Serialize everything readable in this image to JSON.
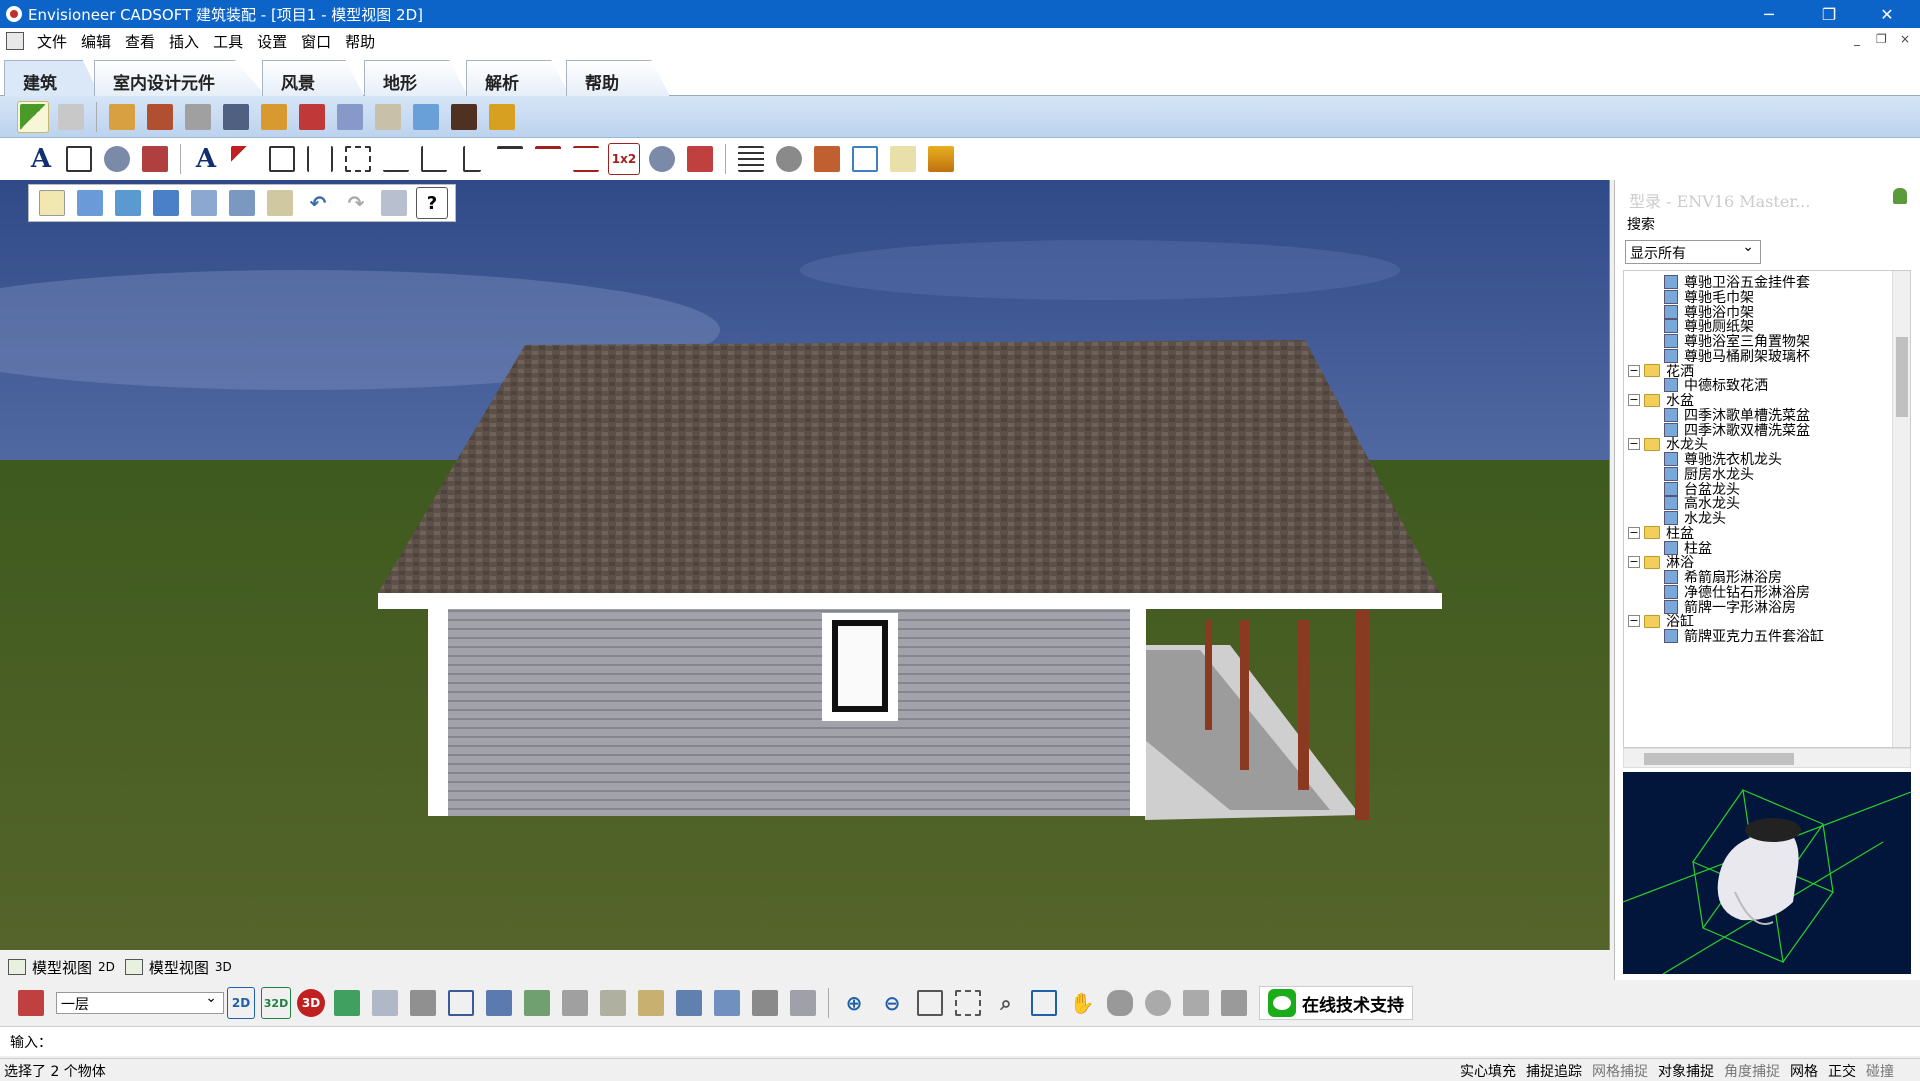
{
  "window": {
    "title": "Envisioneer CADSOFT 建筑装配 - [项目1 - 模型视图 2D]",
    "controls": [
      "─",
      "❐",
      "✕"
    ]
  },
  "menu": [
    "文件",
    "编辑",
    "查看",
    "插入",
    "工具",
    "设置",
    "窗口",
    "帮助"
  ],
  "mdi_controls": [
    "_",
    "❐",
    "×"
  ],
  "ribbon_tabs": [
    "建筑",
    "室内设计元件",
    "风景",
    "地形",
    "解析",
    "帮助"
  ],
  "toolbar": {
    "text_icon": "A",
    "button_1x2": "1x2",
    "help": "?"
  },
  "catalog": {
    "title": "型录 - ENV16 Master...",
    "search_label": "搜索",
    "filter": "显示所有",
    "tree": [
      {
        "type": "leaf",
        "label": "尊驰卫浴五金挂件套"
      },
      {
        "type": "leaf",
        "label": "尊驰毛巾架"
      },
      {
        "type": "leaf",
        "label": "尊驰浴巾架"
      },
      {
        "type": "leaf",
        "label": "尊驰厕纸架"
      },
      {
        "type": "leaf",
        "label": "尊驰浴室三角置物架"
      },
      {
        "type": "leaf",
        "label": "尊驰马桶刷架玻璃杯"
      },
      {
        "type": "folder",
        "label": "花洒"
      },
      {
        "type": "leaf",
        "label": "中德标致花洒"
      },
      {
        "type": "folder",
        "label": "水盆"
      },
      {
        "type": "leaf",
        "label": "四季沐歌单槽洗菜盆"
      },
      {
        "type": "leaf",
        "label": "四季沐歌双槽洗菜盆"
      },
      {
        "type": "folder",
        "label": "水龙头"
      },
      {
        "type": "leaf",
        "label": "尊驰洗衣机龙头"
      },
      {
        "type": "leaf",
        "label": "厨房水龙头"
      },
      {
        "type": "leaf",
        "label": "台盆龙头"
      },
      {
        "type": "leaf",
        "label": "高水龙头"
      },
      {
        "type": "leaf",
        "label": "水龙头"
      },
      {
        "type": "folder",
        "label": "柱盆"
      },
      {
        "type": "leaf",
        "label": "柱盆"
      },
      {
        "type": "folder",
        "label": "淋浴"
      },
      {
        "type": "leaf",
        "label": "希箭扇形淋浴房"
      },
      {
        "type": "leaf",
        "label": "净德仕钻石形淋浴房"
      },
      {
        "type": "leaf",
        "label": "箭牌一字形淋浴房"
      },
      {
        "type": "folder",
        "label": "浴缸"
      },
      {
        "type": "leaf",
        "label": "箭牌亚克力五件套浴缸"
      }
    ]
  },
  "view_tabs": [
    {
      "label": "模型视图",
      "mode": "2D"
    },
    {
      "label": "模型视图",
      "mode": "3D"
    }
  ],
  "floor": "一层",
  "bottom_icons": {
    "view_2d": "2D",
    "view_32d": "32D",
    "view_3d": "3D"
  },
  "support_button": "在线技术支持",
  "input_label": "输入：",
  "status": {
    "message": "选择了 2 个物体",
    "flags": [
      {
        "label": "实心填充",
        "on": true
      },
      {
        "label": "捕捉追踪",
        "on": true
      },
      {
        "label": "网格捕捉",
        "on": false
      },
      {
        "label": "对象捕捉",
        "on": true
      },
      {
        "label": "角度捕捉",
        "on": false
      },
      {
        "label": "网格",
        "on": true
      },
      {
        "label": "正交",
        "on": true
      },
      {
        "label": "碰撞",
        "on": false
      }
    ]
  },
  "colors": {
    "titlebar": "#0c64c8",
    "sky": "#3c5a98",
    "grass": "#4a5a26",
    "siding": "#9a9aa2",
    "roof": "#5c5048"
  }
}
